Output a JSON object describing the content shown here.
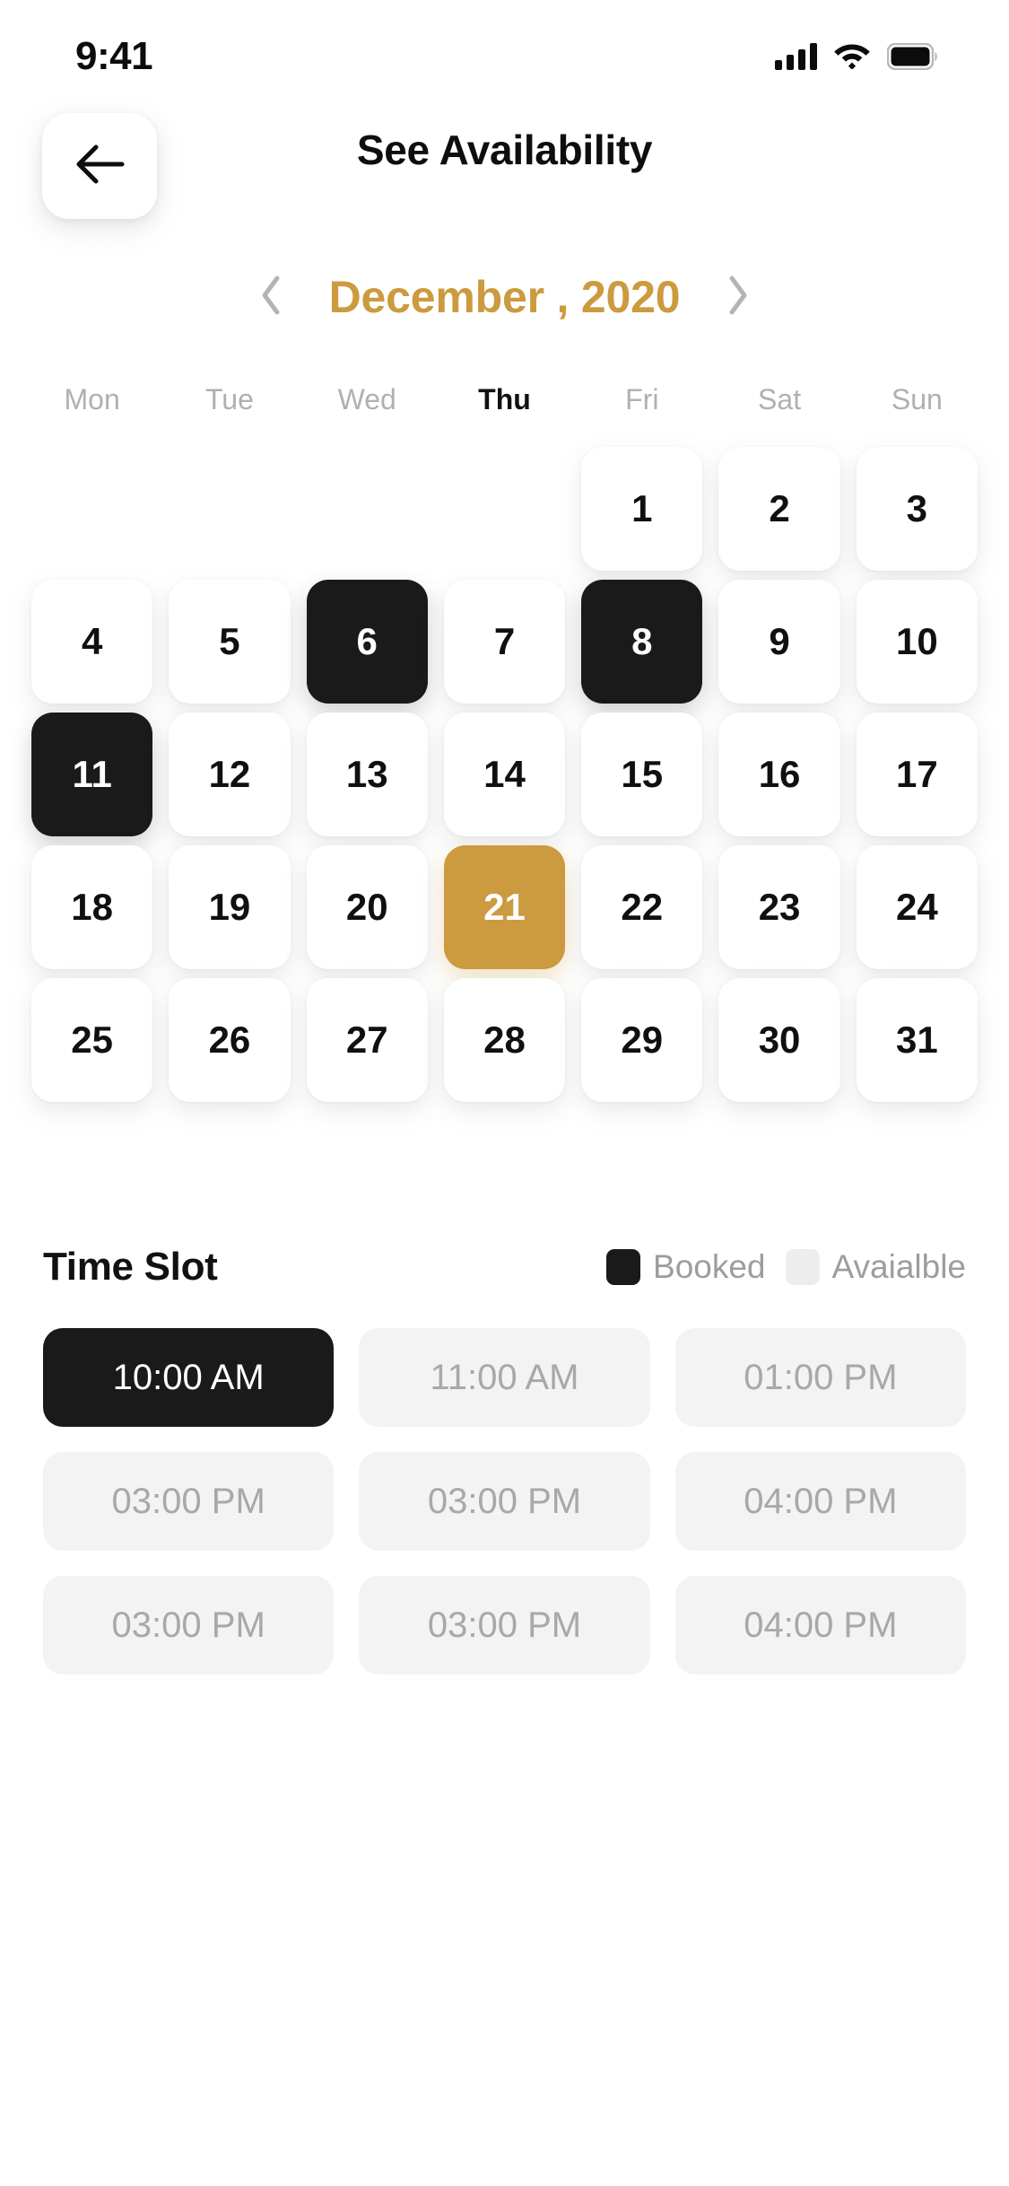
{
  "status_bar": {
    "time": "9:41",
    "signal_icon": "cellular-signal-icon",
    "wifi_icon": "wifi-icon",
    "battery_icon": "battery-icon"
  },
  "header": {
    "title": "See Availability",
    "back_icon": "arrow-left-icon"
  },
  "month_nav": {
    "prev_icon": "chevron-left-icon",
    "next_icon": "chevron-right-icon",
    "label": "December , 2020",
    "accent_color": "#cc9a3f"
  },
  "calendar": {
    "weekdays": [
      {
        "label": "Mon",
        "active": false
      },
      {
        "label": "Tue",
        "active": false
      },
      {
        "label": "Wed",
        "active": false
      },
      {
        "label": "Thu",
        "active": true
      },
      {
        "label": "Fri",
        "active": false
      },
      {
        "label": "Sat",
        "active": false
      },
      {
        "label": "Sun",
        "active": false
      }
    ],
    "weeks": [
      [
        {
          "label": "",
          "state": "empty"
        },
        {
          "label": "",
          "state": "empty"
        },
        {
          "label": "",
          "state": "empty"
        },
        {
          "label": "",
          "state": "empty"
        },
        {
          "label": "1",
          "state": "normal"
        },
        {
          "label": "2",
          "state": "normal"
        },
        {
          "label": "3",
          "state": "normal"
        }
      ],
      [
        {
          "label": "4",
          "state": "normal"
        },
        {
          "label": "5",
          "state": "normal"
        },
        {
          "label": "6",
          "state": "booked"
        },
        {
          "label": "7",
          "state": "normal"
        },
        {
          "label": "8",
          "state": "booked"
        },
        {
          "label": "9",
          "state": "normal"
        },
        {
          "label": "10",
          "state": "normal"
        }
      ],
      [
        {
          "label": "11",
          "state": "booked"
        },
        {
          "label": "12",
          "state": "normal"
        },
        {
          "label": "13",
          "state": "normal"
        },
        {
          "label": "14",
          "state": "normal"
        },
        {
          "label": "15",
          "state": "normal"
        },
        {
          "label": "16",
          "state": "normal"
        },
        {
          "label": "17",
          "state": "normal"
        }
      ],
      [
        {
          "label": "18",
          "state": "normal"
        },
        {
          "label": "19",
          "state": "normal"
        },
        {
          "label": "20",
          "state": "normal"
        },
        {
          "label": "21",
          "state": "selected"
        },
        {
          "label": "22",
          "state": "normal"
        },
        {
          "label": "23",
          "state": "normal"
        },
        {
          "label": "24",
          "state": "normal"
        }
      ],
      [
        {
          "label": "25",
          "state": "normal"
        },
        {
          "label": "26",
          "state": "normal"
        },
        {
          "label": "27",
          "state": "normal"
        },
        {
          "label": "28",
          "state": "normal"
        },
        {
          "label": "29",
          "state": "normal"
        },
        {
          "label": "30",
          "state": "normal"
        },
        {
          "label": "31",
          "state": "normal"
        }
      ]
    ],
    "booked_color": "#1a1a1a",
    "selected_color": "#cc9a3f"
  },
  "time_slot": {
    "title": "Time Slot",
    "legend": [
      {
        "label": "Booked",
        "state": "booked"
      },
      {
        "label": "Avaialble",
        "state": "available"
      }
    ],
    "slots": [
      {
        "label": "10:00 AM",
        "state": "booked"
      },
      {
        "label": "11:00 AM",
        "state": "available"
      },
      {
        "label": "01:00 PM",
        "state": "available"
      },
      {
        "label": "03:00 PM",
        "state": "available"
      },
      {
        "label": "03:00 PM",
        "state": "available"
      },
      {
        "label": "04:00 PM",
        "state": "available"
      },
      {
        "label": "03:00 PM",
        "state": "available"
      },
      {
        "label": "03:00 PM",
        "state": "available"
      },
      {
        "label": "04:00 PM",
        "state": "available"
      }
    ]
  }
}
